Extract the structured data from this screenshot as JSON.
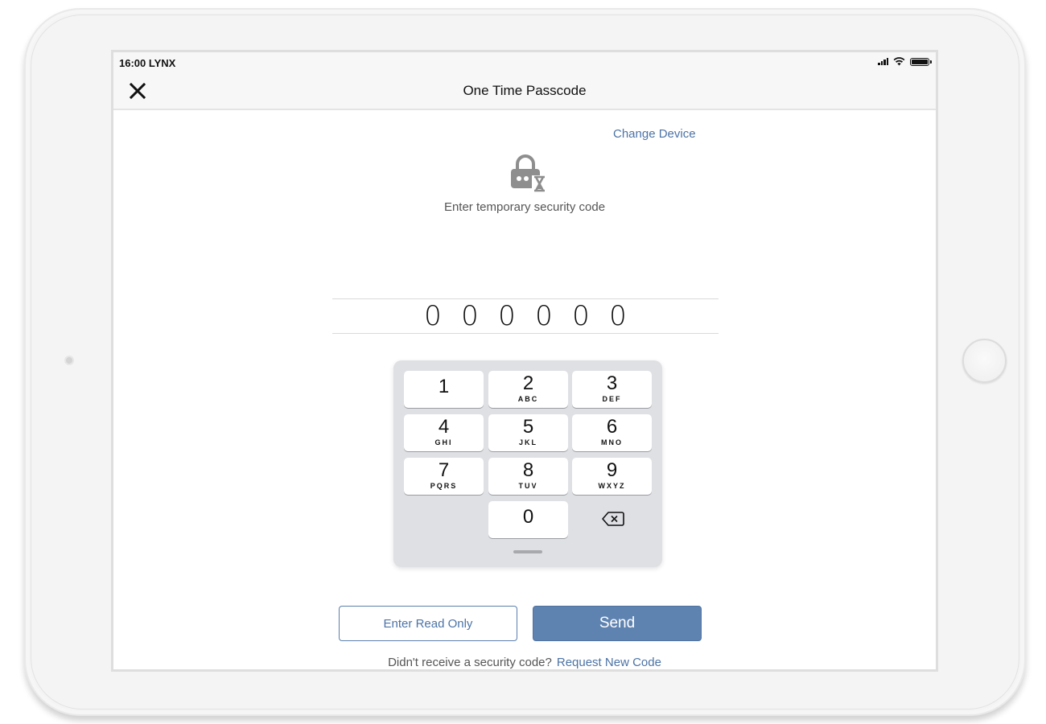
{
  "status_bar": {
    "time": "16:00",
    "carrier": "LYNX",
    "icons": [
      "signal-icon",
      "wifi-icon",
      "battery-icon"
    ],
    "battery_level": 1.0
  },
  "nav": {
    "title": "One Time Passcode",
    "close_icon": "close-icon"
  },
  "content": {
    "change_device_label": "Change Device",
    "lock_icon": "lock-timer-icon",
    "instruction": "Enter temporary security code",
    "code_digits": [
      "0",
      "0",
      "0",
      "0",
      "0",
      "0"
    ]
  },
  "keypad": {
    "keys": [
      {
        "num": "1",
        "letters": ""
      },
      {
        "num": "2",
        "letters": "ABC"
      },
      {
        "num": "3",
        "letters": "DEF"
      },
      {
        "num": "4",
        "letters": "GHI"
      },
      {
        "num": "5",
        "letters": "JKL"
      },
      {
        "num": "6",
        "letters": "MNO"
      },
      {
        "num": "7",
        "letters": "PQRS"
      },
      {
        "num": "8",
        "letters": "TUV"
      },
      {
        "num": "9",
        "letters": "WXYZ"
      },
      {
        "num": "0",
        "letters": ""
      }
    ],
    "delete_icon": "backspace-icon"
  },
  "actions": {
    "read_only_label": "Enter Read Only",
    "send_label": "Send"
  },
  "footer": {
    "prompt": "Didn't receive a security code?",
    "link_label": "Request New Code"
  },
  "colors": {
    "accent": "#4c73a6",
    "send_button": "#5f83b1",
    "keypad_bg": "#dfe0e4"
  }
}
